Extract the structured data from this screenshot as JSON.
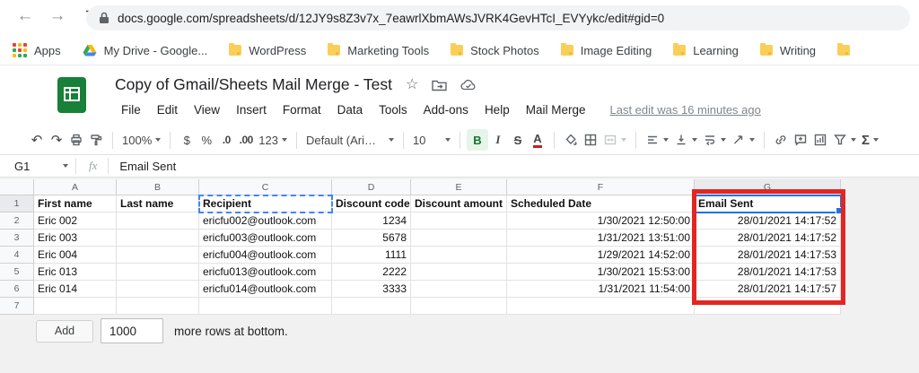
{
  "icons": {
    "back": "←",
    "forward": "→",
    "reload": "↻",
    "undo": "↶",
    "redo": "↷",
    "star": "☆"
  },
  "browser": {
    "url": "docs.google.com/spreadsheets/d/12JY9s8Z3v7x_7eawrlXbmAWsJVRK4GevHTcI_EVYykc/edit#gid=0",
    "bookmarks": [
      "Apps",
      "My Drive - Google...",
      "WordPress",
      "Marketing Tools",
      "Stock Photos",
      "Image Editing",
      "Learning",
      "Writing"
    ]
  },
  "doc": {
    "title": "Copy of Gmail/Sheets Mail Merge - Test",
    "menus": [
      "File",
      "Edit",
      "View",
      "Insert",
      "Format",
      "Data",
      "Tools",
      "Add-ons",
      "Help",
      "Mail Merge"
    ],
    "last_edit": "Last edit was 16 minutes ago"
  },
  "toolbar": {
    "zoom": "100%",
    "currency": "$",
    "percent": "%",
    "dec_decrease": ".0",
    "dec_increase": ".00",
    "more_formats": "123",
    "font": "Default (Ari…",
    "font_size": "10",
    "bold": "B",
    "italic": "I",
    "strikethrough": "S",
    "text_color": "A",
    "functions": "Σ"
  },
  "formula_bar": {
    "cell_ref": "G1",
    "fx": "fx",
    "content": "Email Sent"
  },
  "grid": {
    "col_headers": [
      "A",
      "B",
      "C",
      "D",
      "E",
      "F",
      "G"
    ],
    "row_headers": [
      "1",
      "2",
      "3",
      "4",
      "5",
      "6",
      "7"
    ],
    "rows": [
      {
        "cells": [
          "First name",
          "Last name",
          "Recipient",
          "Discount code",
          "Discount amount",
          "Scheduled Date",
          "Email Sent"
        ]
      },
      {
        "cells": [
          "Eric 002",
          "",
          "ericfu002@outlook.com",
          "1234",
          "",
          "1/30/2021 12:50:00",
          "28/01/2021 14:17:52"
        ]
      },
      {
        "cells": [
          "Eric 003",
          "",
          "ericfu003@outlook.com",
          "5678",
          "",
          "1/31/2021 13:51:00",
          "28/01/2021 14:17:52"
        ]
      },
      {
        "cells": [
          "Eric 004",
          "",
          "ericfu004@outlook.com",
          "1111",
          "",
          "1/29/2021 14:52:00",
          "28/01/2021 14:17:53"
        ]
      },
      {
        "cells": [
          "Eric 013",
          "",
          "ericfu013@outlook.com",
          "2222",
          "",
          "1/30/2021 15:53:00",
          "28/01/2021 14:17:53"
        ]
      },
      {
        "cells": [
          "Eric 014",
          "",
          "ericfu014@outlook.com",
          "3333",
          "",
          "1/31/2021 11:54:00",
          "28/01/2021 14:17:57"
        ]
      },
      {
        "cells": [
          "",
          "",
          "",
          "",
          "",
          "",
          ""
        ]
      }
    ]
  },
  "footer": {
    "add_label": "Add",
    "rows_value": "1000",
    "suffix": "more rows at bottom."
  },
  "colors": {
    "accent_blue": "#1a73e8",
    "annotation_red": "#e22621",
    "sheets_green": "#188038"
  }
}
